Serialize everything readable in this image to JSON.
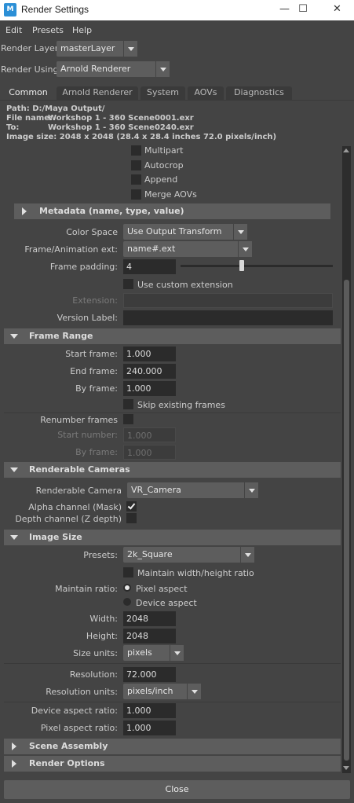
{
  "window": {
    "title": "Render Settings",
    "app_icon": "M",
    "minimize": "—",
    "maximize": "☐",
    "close": "✕"
  },
  "menu": [
    "Edit",
    "Presets",
    "Help"
  ],
  "render_layer": {
    "label": "Render Layer",
    "value": "masterLayer"
  },
  "render_using": {
    "label": "Render Using",
    "value": "Arnold Renderer"
  },
  "tabs": [
    "Common",
    "Arnold Renderer",
    "System",
    "AOVs",
    "Diagnostics"
  ],
  "info": {
    "path": "Path: D:/Maya Output/",
    "file_name_label": "File name:",
    "file_name": "Workshop 1 - 360 Scene0001.exr",
    "to_label": "To:",
    "to": "Workshop 1 - 360 Scene0240.exr",
    "image_size": "Image size: 2048 x 2048 (28.4 x 28.4 inches 72.0 pixels/inch)"
  },
  "file_output": {
    "multipart": "Multipart",
    "autocrop": "Autocrop",
    "append": "Append",
    "merge_aovs": "Merge AOVs",
    "metadata": "Metadata (name, type, value)",
    "color_space_label": "Color Space",
    "color_space": "Use Output Transform",
    "frame_ext_label": "Frame/Animation ext:",
    "frame_ext": "name#.ext",
    "frame_padding_label": "Frame padding:",
    "frame_padding": "4",
    "frame_padding_slider_fraction": 0.4,
    "use_custom_ext": "Use custom extension",
    "extension_label": "Extension:",
    "version_label": "Version Label:"
  },
  "frame_range": {
    "title": "Frame Range",
    "start_label": "Start frame:",
    "start": "1.000",
    "end_label": "End frame:",
    "end": "240.000",
    "by_label": "By frame:",
    "by": "1.000",
    "skip_existing": "Skip existing frames",
    "renumber": "Renumber frames",
    "start_number_label": "Start number:",
    "start_number": "1.000",
    "by_frame2_label": "By frame:",
    "by_frame2": "1.000"
  },
  "cameras": {
    "title": "Renderable Cameras",
    "camera_label": "Renderable Camera",
    "camera": "VR_Camera",
    "alpha_label": "Alpha channel (Mask)",
    "depth_label": "Depth channel (Z depth)"
  },
  "image_size": {
    "title": "Image Size",
    "presets_label": "Presets:",
    "presets": "2k_Square",
    "maintain_wh": "Maintain width/height ratio",
    "maintain_ratio_label": "Maintain ratio:",
    "pixel_aspect": "Pixel aspect",
    "device_aspect": "Device aspect",
    "width_label": "Width:",
    "width": "2048",
    "height_label": "Height:",
    "height": "2048",
    "size_units_label": "Size units:",
    "size_units": "pixels",
    "resolution_label": "Resolution:",
    "resolution": "72.000",
    "res_units_label": "Resolution units:",
    "res_units": "pixels/inch",
    "device_aspect_label": "Device aspect ratio:",
    "device_aspect_value": "1.000",
    "pixel_aspect_label": "Pixel aspect ratio:",
    "pixel_aspect_value": "1.000"
  },
  "collapsed_sections": [
    "Scene Assembly",
    "Render Options"
  ],
  "close_label": "Close",
  "colors": {
    "background": "#444444",
    "field": "#2b2b2b",
    "section": "#5d5d5d",
    "titlebar": "#ffffff",
    "app_icon": "#2b8fd6"
  }
}
